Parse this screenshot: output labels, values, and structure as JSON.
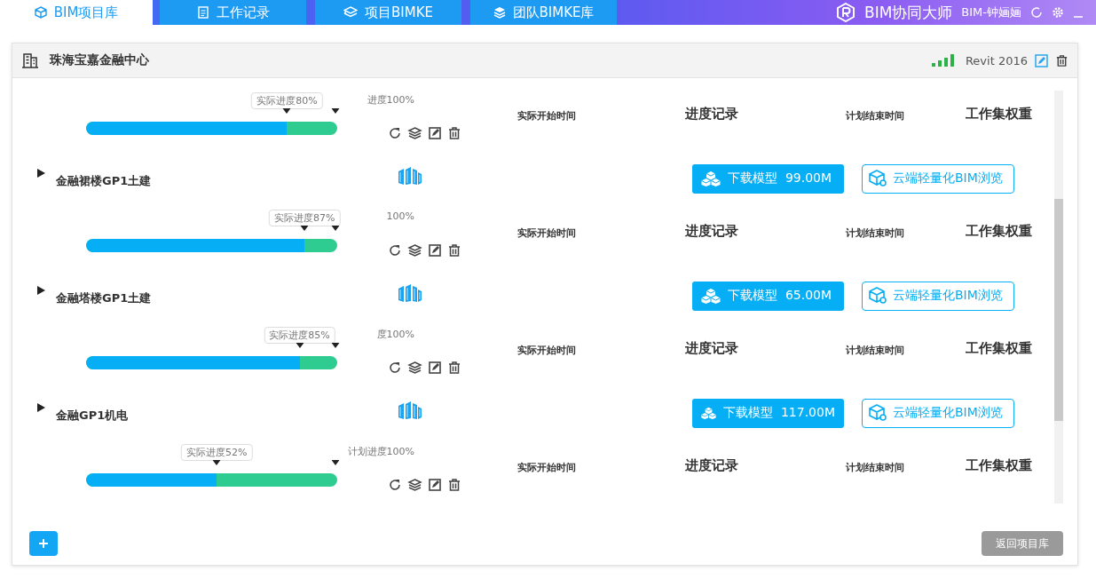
{
  "nav": {
    "tabs": [
      {
        "label": "BIM项目库",
        "selected": true
      },
      {
        "label": "工作记录",
        "selected": false
      },
      {
        "label": "项目BIMKE",
        "selected": false
      },
      {
        "label": "团队BIMKE库",
        "selected": false
      }
    ],
    "app_title": "BIM协同大师",
    "user": "BIM-钟婳婳"
  },
  "project": {
    "title": "珠海宝嘉金融中心",
    "software": "Revit 2016"
  },
  "rows": [
    {
      "kind": "progress",
      "actual_label": "实际进度80%",
      "plan_label": "进度100%",
      "level": 0.8,
      "columns": [
        "实际开始时间",
        "进度记录",
        "计划结束时间",
        "工作集权重"
      ]
    },
    {
      "kind": "model",
      "name": "金融裙楼GP1土建",
      "download": "下载模型  99.00M",
      "browse": "云端轻量化BIM浏览"
    },
    {
      "kind": "progress",
      "actual_label": "实际进度87%",
      "plan_label": "100%",
      "level": 0.87,
      "columns": [
        "实际开始时间",
        "进度记录",
        "计划结束时间",
        "工作集权重"
      ]
    },
    {
      "kind": "model",
      "name": "金融塔楼GP1土建",
      "download": "下载模型  65.00M",
      "browse": "云端轻量化BIM浏览"
    },
    {
      "kind": "progress",
      "actual_label": "实际进度85%",
      "plan_label": "度100%",
      "level": 0.85,
      "columns": [
        "实际开始时间",
        "进度记录",
        "计划结束时间",
        "工作集权重"
      ]
    },
    {
      "kind": "model",
      "name": "金融GP1机电",
      "download": "下载模型  117.00M",
      "browse": "云端轻量化BIM浏览"
    },
    {
      "kind": "progress",
      "actual_label": "实际进度52%",
      "plan_label": "计划进度100%",
      "level": 0.52,
      "columns": [
        "实际开始时间",
        "进度记录",
        "计划结束时间",
        "工作集权重"
      ]
    }
  ],
  "footer": {
    "back_button": "返回项目库"
  }
}
